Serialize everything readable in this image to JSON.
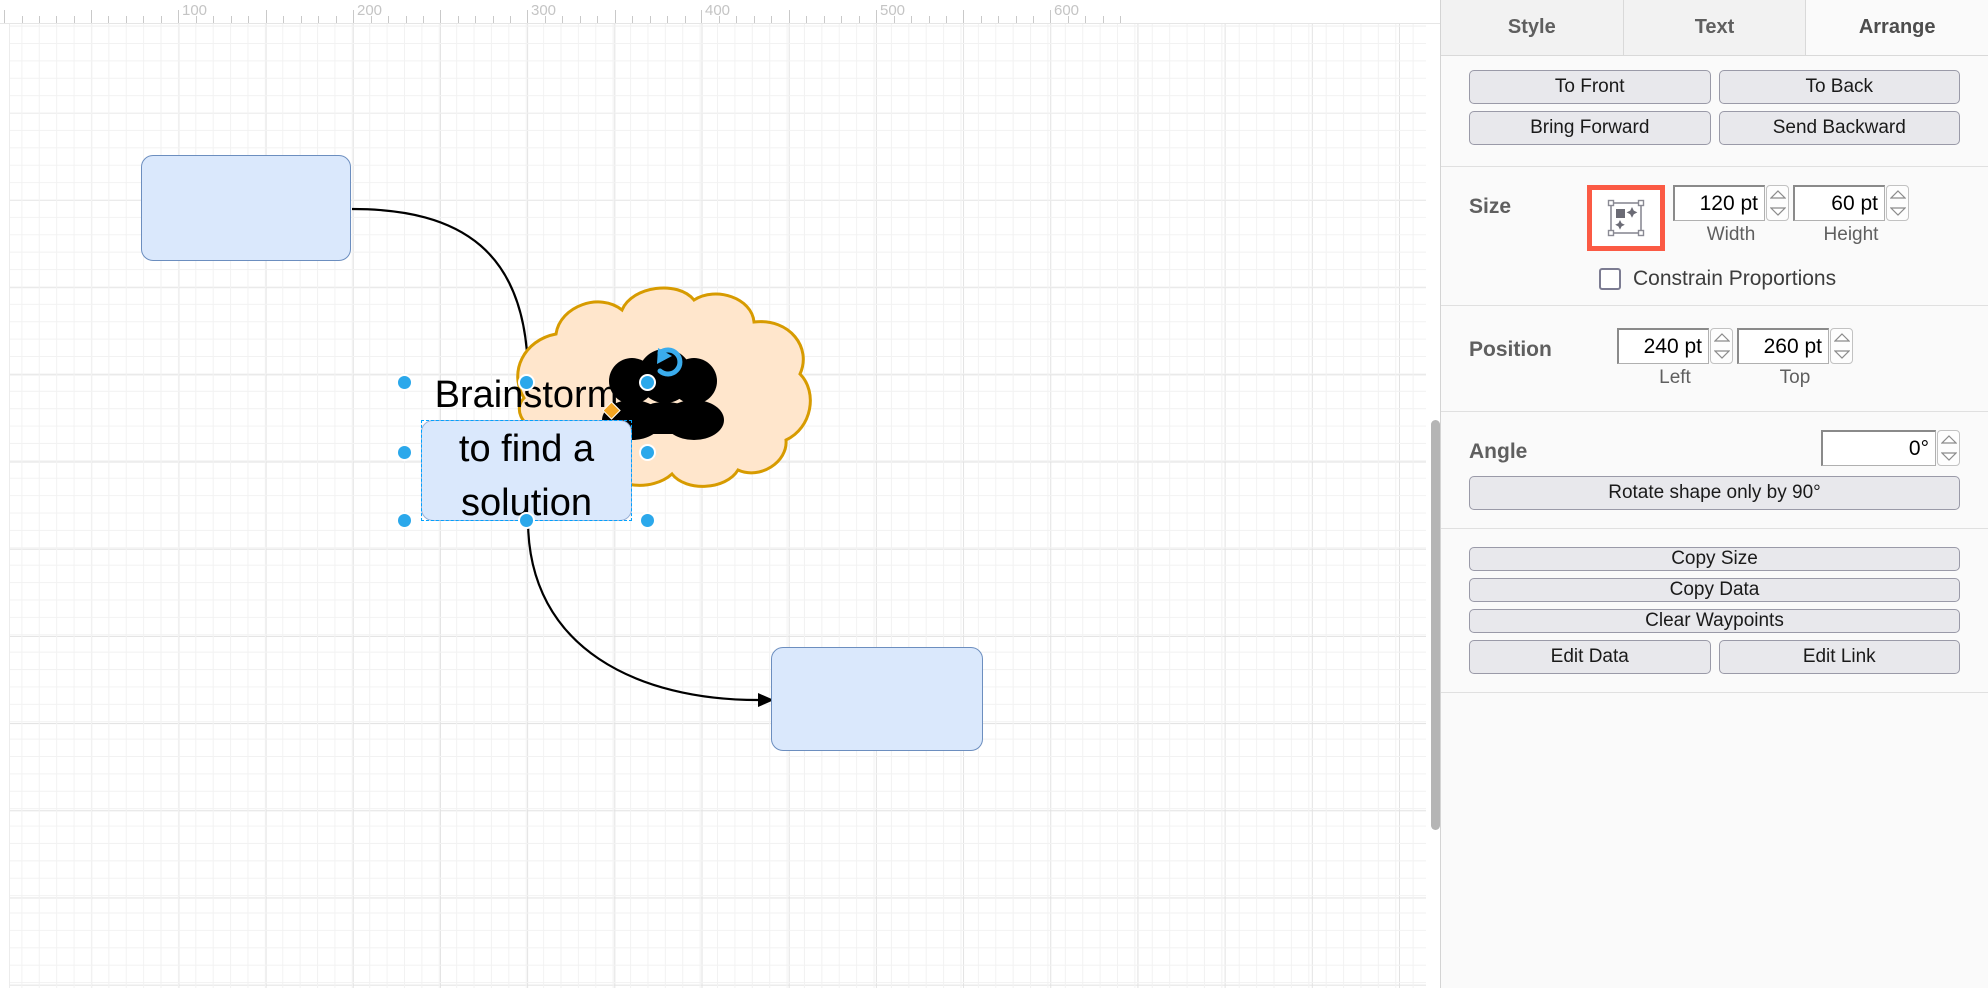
{
  "canvas": {
    "ruler": {
      "unit_labels": [
        "100",
        "200",
        "300",
        "400",
        "500",
        "600"
      ]
    },
    "shapes": [
      {
        "name": "top-left-box",
        "label": ""
      },
      {
        "name": "bottom-right-box",
        "label": ""
      },
      {
        "name": "cloud-shape",
        "label": "",
        "icon": "people-group-icon"
      },
      {
        "name": "selected-box",
        "label": "Brainstorm\nto find a\nsolution"
      }
    ],
    "selection": {
      "rotate_icon": "rotate-icon",
      "handle_count": 8,
      "constraint_handle": "orange-diamond-handle"
    },
    "colors": {
      "box_fill": "#dae8fc",
      "box_stroke": "#6c8ebf",
      "cloud_fill": "#ffe6cc",
      "cloud_stroke": "#d79b00",
      "handle": "#2ba8eb",
      "constraint_handle": "#f5a623",
      "edge": "#000000"
    }
  },
  "panel": {
    "tabs": [
      {
        "label": "Style",
        "active": false
      },
      {
        "label": "Text",
        "active": false
      },
      {
        "label": "Arrange",
        "active": true
      }
    ],
    "order": {
      "to_front": "To Front",
      "to_back": "To Back",
      "bring_forward": "Bring Forward",
      "send_backward": "Send Backward"
    },
    "size": {
      "label": "Size",
      "autosize_icon": "autosize-icon",
      "width_value": "120 pt",
      "height_value": "60 pt",
      "width_label": "Width",
      "height_label": "Height",
      "constrain_label": "Constrain Proportions",
      "constrain_checked": false,
      "highlight_color": "#fb5a44"
    },
    "position": {
      "label": "Position",
      "left_value": "240 pt",
      "top_value": "260 pt",
      "left_label": "Left",
      "top_label": "Top"
    },
    "angle": {
      "label": "Angle",
      "value": "0°",
      "rotate_button": "Rotate shape only by 90°"
    },
    "actions": {
      "copy_size": "Copy Size",
      "copy_data": "Copy Data",
      "clear_waypoints": "Clear Waypoints",
      "edit_data": "Edit Data",
      "edit_link": "Edit Link"
    }
  }
}
